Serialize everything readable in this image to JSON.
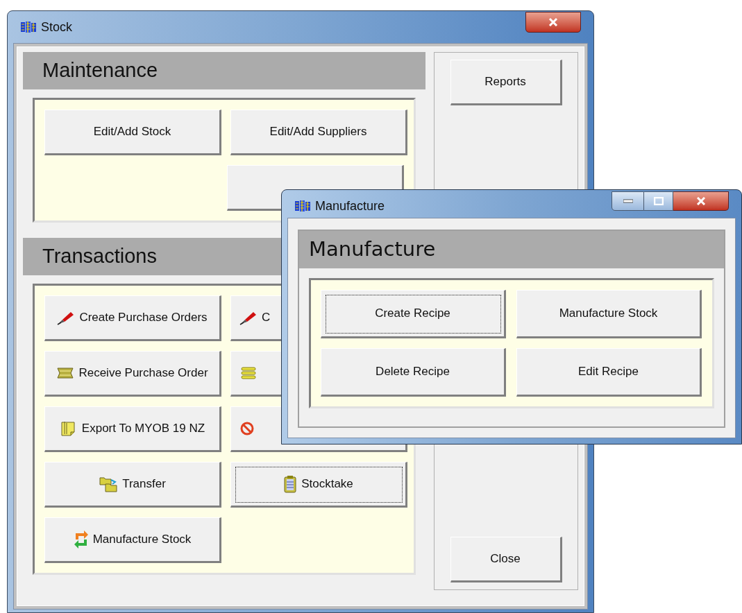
{
  "stock_window": {
    "title": "Stock",
    "sections": [
      {
        "title": "Maintenance",
        "rows": [
          [
            {
              "kind": "plain",
              "label": "Edit/Add Stock",
              "focused": false,
              "covered": false
            },
            {
              "kind": "plain",
              "label": "Edit/Add Suppliers",
              "focused": false,
              "covered": false
            }
          ],
          [
            {
              "kind": "empty"
            },
            {
              "kind": "plain",
              "focused": false
            }
          ]
        ]
      },
      {
        "title": "Transactions",
        "rows": [
          [
            {
              "kind": "pen",
              "label": "Create Purchase Orders",
              "focused": false,
              "covered": false
            },
            {
              "kind": "pen",
              "label": "C",
              "focused": false,
              "covered": true
            }
          ],
          [
            {
              "kind": "bundle",
              "label": "Receive Purchase Order",
              "focused": false,
              "covered": false
            },
            {
              "kind": "stack",
              "focused": false,
              "covered": true
            }
          ],
          [
            {
              "kind": "note",
              "label": "Export To MYOB 19 NZ",
              "focused": false,
              "covered": false
            },
            {
              "kind": "nosign",
              "focused": false,
              "covered": true
            }
          ],
          [
            {
              "kind": "transfer",
              "label": "Transfer",
              "focused": false,
              "covered": false
            },
            {
              "kind": "clipboard",
              "label": "Stocktake",
              "focused": true,
              "covered": false
            }
          ],
          [
            {
              "kind": "cycle",
              "label": "Manufacture Stock",
              "focused": false,
              "covered": false
            }
          ]
        ]
      }
    ],
    "side_buttons": [
      {
        "label": "Reports",
        "focused": false
      },
      {
        "label": "Close",
        "focused": false
      }
    ]
  },
  "manufacture_window": {
    "title": "Manufacture",
    "heading": "Manufacture",
    "buttons": [
      {
        "label": "Create Recipe",
        "focused": true
      },
      {
        "label": "Manufacture Stock",
        "focused": false
      },
      {
        "label": "Delete Recipe",
        "focused": false
      },
      {
        "label": "Edit Recipe",
        "focused": false
      }
    ]
  }
}
